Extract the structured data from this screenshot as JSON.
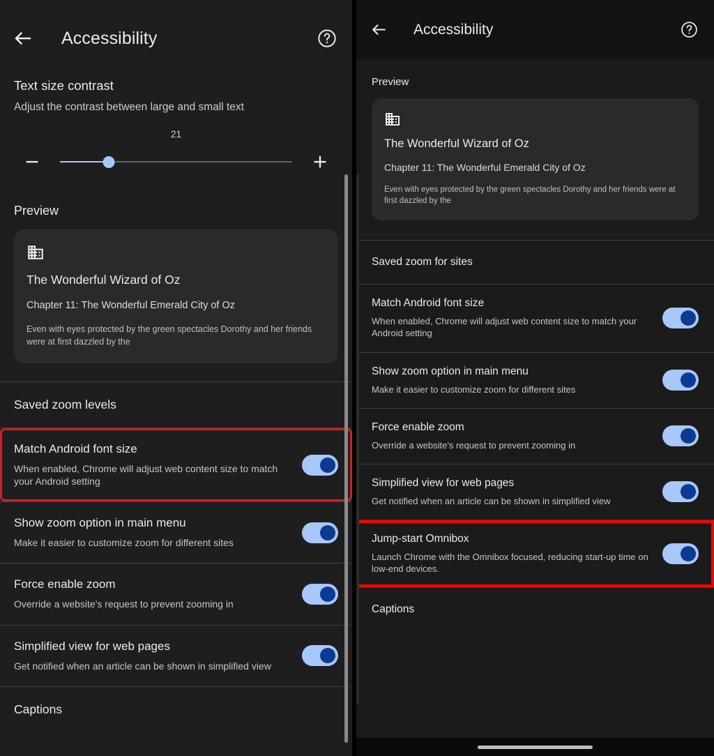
{
  "left_panel": {
    "appbar": {
      "back_icon": "arrow-back-icon",
      "title": "Accessibility",
      "help_icon": "help-circle-icon"
    },
    "text_size_contrast": {
      "title": "Text size contrast",
      "summary": "Adjust the contrast between large and small text",
      "value": "21",
      "decrease_label": "−",
      "increase_label": "+",
      "slider_percent": 21
    },
    "preview": {
      "label": "Preview",
      "card": {
        "icon": "domain-building-icon",
        "title": "The Wonderful Wizard of Oz",
        "chapter": "Chapter 11: The Wonderful Emerald City of Oz",
        "body": "Even with eyes protected by the green spectacles Dorothy and her friends were at first dazzled by the"
      }
    },
    "group_header": "Saved zoom levels",
    "rows": [
      {
        "title": "Match Android font size",
        "summary": "When enabled, Chrome will adjust web content size to match your Android setting",
        "toggle_on": true,
        "highlighted": true
      },
      {
        "title": "Show zoom option in main menu",
        "summary": "Make it easier to customize zoom for different sites",
        "toggle_on": true,
        "highlighted": false
      },
      {
        "title": "Force enable zoom",
        "summary": "Override a website's request to prevent zooming in",
        "toggle_on": true,
        "highlighted": false
      },
      {
        "title": "Simplified view for web pages",
        "summary": "Get notified when an article can be shown in simplified view",
        "toggle_on": true,
        "highlighted": false
      }
    ],
    "footer_header": "Captions",
    "highlight_color": "#cf2222"
  },
  "right_panel": {
    "appbar": {
      "back_icon": "arrow-back-icon",
      "title": "Accessibility",
      "help_icon": "help-circle-icon"
    },
    "preview": {
      "label": "Preview",
      "card": {
        "icon": "domain-building-icon",
        "title": "The Wonderful Wizard of Oz",
        "chapter": "Chapter 11: The Wonderful Emerald City of Oz",
        "body": "Even with eyes protected by the green spectacles Dorothy and her friends were at first dazzled by the"
      }
    },
    "group_header": "Saved zoom for sites",
    "rows": [
      {
        "title": "Match Android font size",
        "summary": "When enabled, Chrome will adjust web content size to match your Android setting",
        "toggle_on": true,
        "highlighted": false
      },
      {
        "title": "Show zoom option in main menu",
        "summary": "Make it easier to customize zoom for different sites",
        "toggle_on": true,
        "highlighted": false
      },
      {
        "title": "Force enable zoom",
        "summary": "Override a website's request to prevent zooming in",
        "toggle_on": true,
        "highlighted": false
      },
      {
        "title": "Simplified view for web pages",
        "summary": "Get notified when an article can be shown in simplified view",
        "toggle_on": true,
        "highlighted": false
      },
      {
        "title": "Jump-start Omnibox",
        "summary": "Launch Chrome with the Omnibox focused, reducing start-up time on low-end devices.",
        "toggle_on": true,
        "highlighted": true
      }
    ],
    "footer_header": "Captions",
    "highlight_color": "#ff0000",
    "nav_pill": "gesture-nav-pill"
  },
  "colors": {
    "toggle_track": "#a8c7fa",
    "toggle_knob": "#0b3b91",
    "slider_active": "#a8c7fa",
    "slider_inactive": "#5f6368",
    "card_bg": "#282a2c",
    "panel_bg_left": "#1e1e1e",
    "panel_bg_right": "#1b1b1b"
  }
}
